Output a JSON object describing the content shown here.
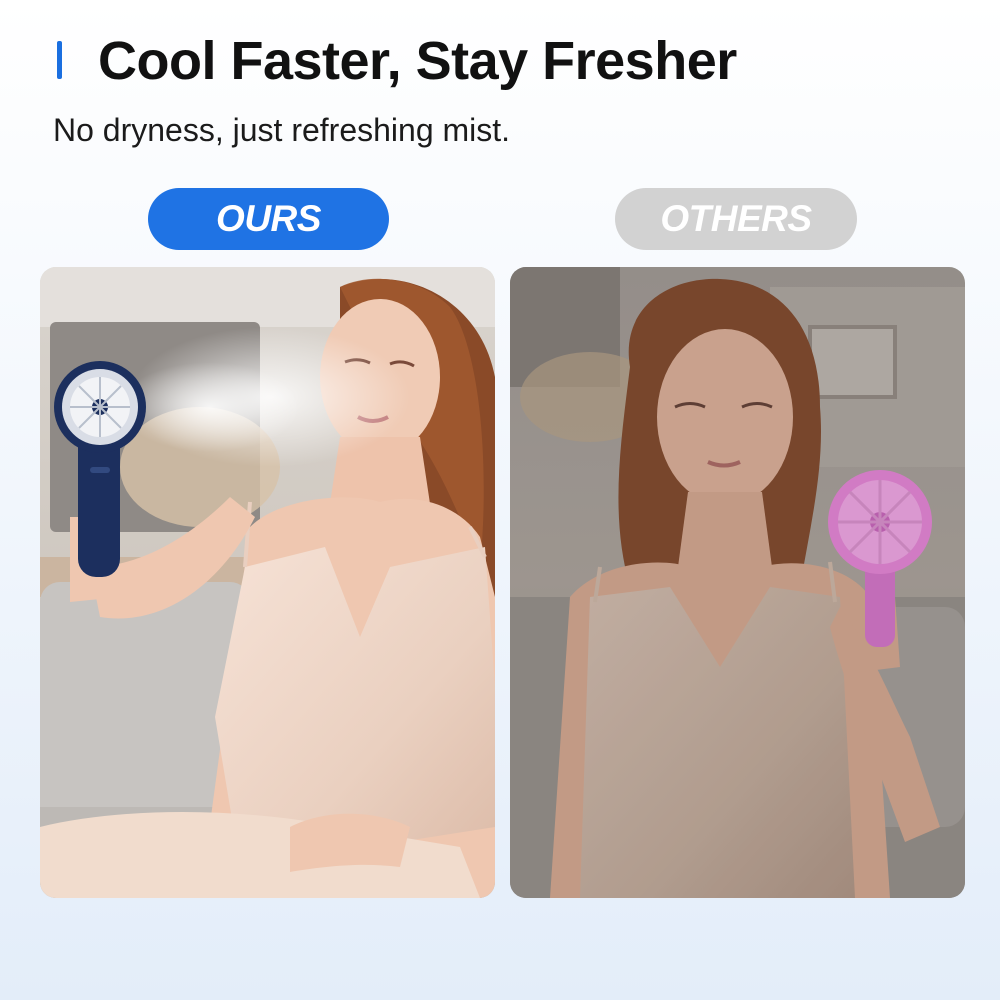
{
  "header": {
    "title": "Cool Faster, Stay Fresher",
    "subtitle": "No dryness, just refreshing mist."
  },
  "comparison": {
    "ours_label": "OURS",
    "others_label": "OTHERS"
  },
  "colors": {
    "accent": "#1f73e4",
    "others_pill": "#d2d2d2",
    "ours_fan": "#1c2f5e",
    "others_fan": "#e07fd2"
  }
}
